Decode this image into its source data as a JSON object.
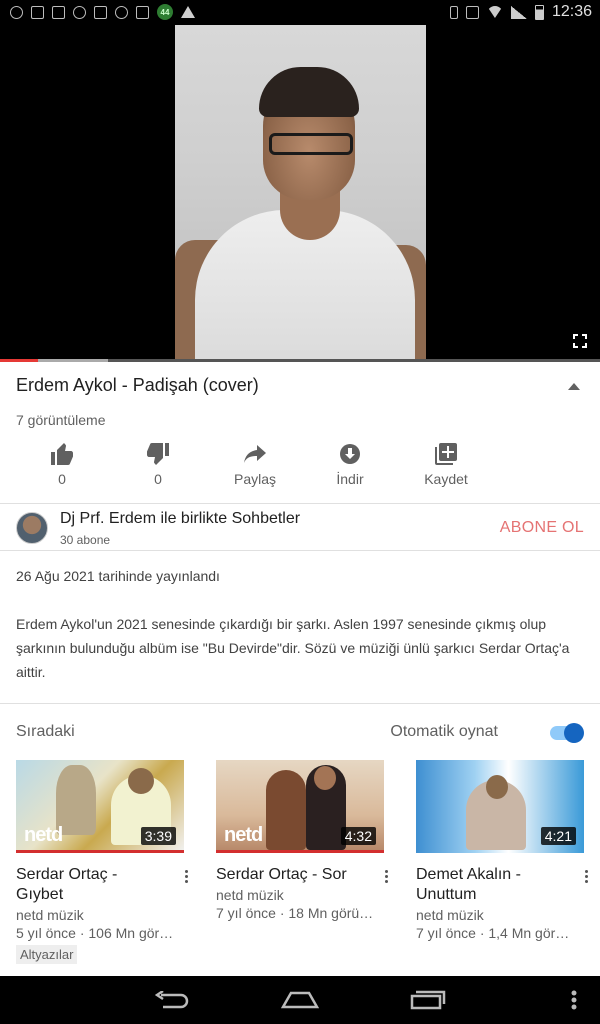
{
  "status_bar": {
    "time": "12:36",
    "badge": "44"
  },
  "player": {
    "progress_played": 0.063,
    "progress_buffered": 0.18,
    "fullscreen_icon": "fullscreen-icon"
  },
  "video": {
    "title": "Erdem Aykol - Padişah (cover)",
    "views": "7 görüntüleme"
  },
  "actions": [
    {
      "icon": "thumb-up-icon",
      "label": "0"
    },
    {
      "icon": "thumb-down-icon",
      "label": "0"
    },
    {
      "icon": "share-icon",
      "label": "Paylaş"
    },
    {
      "icon": "download-icon",
      "label": "İndir"
    },
    {
      "icon": "save-playlist-icon",
      "label": "Kaydet"
    }
  ],
  "channel": {
    "name": "Dj Prf. Erdem ile birlikte Sohbetler",
    "subscribers": "30 abone",
    "subscribe_label": "ABONE OL"
  },
  "description": {
    "published": "26 Ağu 2021 tarihinde yayınlandı",
    "text": "Erdem Aykol'un 2021 senesinde çıkardığı bir şarkı. Aslen 1997 senesinde çıkmış olup şarkının bulunduğu albüm ise \"Bu Devirde\"dir. Sözü ve müziği ünlü şarkıcı Serdar Ortaç'a aittir."
  },
  "up_next": {
    "label": "Sıradaki",
    "autoplay_label": "Otomatik oynat",
    "autoplay_on": true,
    "items": [
      {
        "title": "Serdar Ortaç - Gıybet",
        "channel": "netd müzik",
        "meta": "5 yıl önce · 106 Mn gör…",
        "duration": "3:39",
        "logo": "netd",
        "badge": "Altyazılar"
      },
      {
        "title": "Serdar Ortaç - Sor",
        "channel": "netd müzik",
        "meta": "7 yıl önce · 18 Mn görü…",
        "duration": "4:32",
        "logo": "netd",
        "badge": ""
      },
      {
        "title": "Demet Akalın - Unuttum",
        "channel": "netd müzik",
        "meta": "7 yıl önce · 1,4 Mn gör…",
        "duration": "4:21",
        "logo": "",
        "badge": ""
      }
    ]
  },
  "colors": {
    "accent": "#1565c0",
    "subscribe": "#e57373",
    "progress": "#e53935"
  }
}
